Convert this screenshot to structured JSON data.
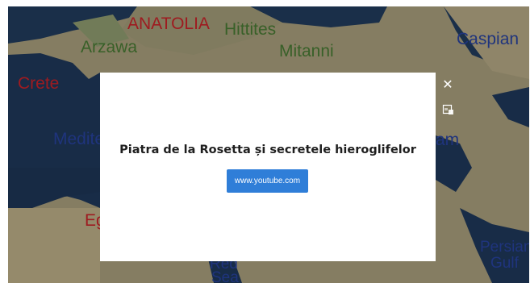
{
  "map": {
    "labels": {
      "anatolia": "ANATOLIA",
      "hittites": "Hittites",
      "arzawa": "Arzawa",
      "mitanni": "Mitanni",
      "caspian": "Caspian",
      "crete": "Crete",
      "medite": "Medite",
      "am": "am",
      "eg": "Eg",
      "red": "Red",
      "sea": "Sea",
      "persian": "Persian",
      "gulf": "Gulf"
    }
  },
  "modal": {
    "title": "Piatra de la Rosetta și secretele hieroglifelor",
    "link_label": "www.youtube.com",
    "close_glyph": "✕",
    "caption_icon": "closed-caption-icon"
  }
}
